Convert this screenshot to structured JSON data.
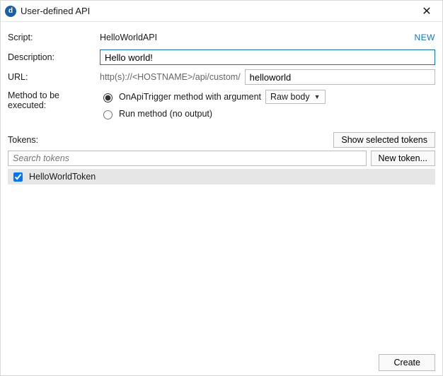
{
  "titlebar": {
    "icon_letter": "d",
    "title": "User-defined API"
  },
  "form": {
    "script_label": "Script:",
    "script_value": "HelloWorldAPI",
    "new_link": "NEW",
    "description_label": "Description:",
    "description_value": "Hello world!",
    "url_label": "URL:",
    "url_prefix": "http(s)://<HOSTNAME>/api/custom/",
    "url_value": "helloworld",
    "method_label": "Method to be executed:",
    "method_option1": "OnApiTrigger method with argument",
    "method_option1_arg": "Raw body",
    "method_option2": "Run method (no output)"
  },
  "tokens": {
    "label": "Tokens:",
    "show_selected": "Show selected tokens",
    "search_placeholder": "Search tokens",
    "new_token": "New token...",
    "items": [
      {
        "name": "HelloWorldToken",
        "checked": true
      }
    ]
  },
  "footer": {
    "create": "Create"
  }
}
